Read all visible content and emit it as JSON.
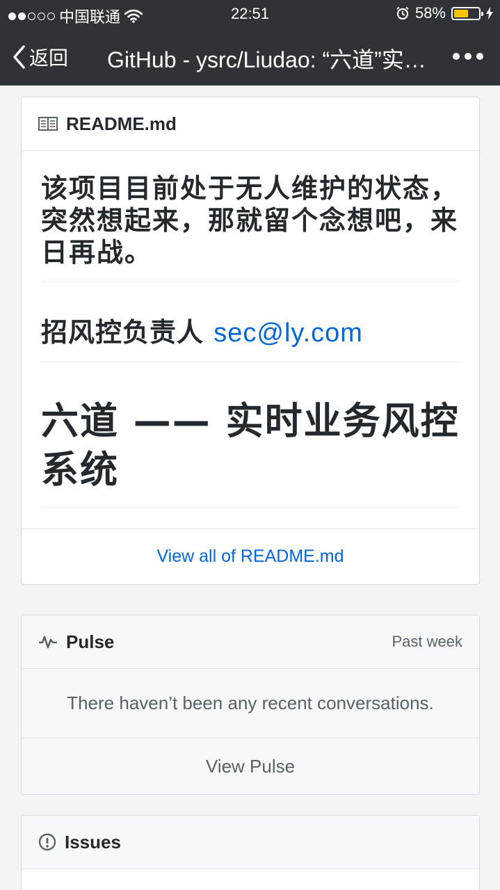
{
  "status_bar": {
    "carrier": "中国联通",
    "time": "22:51",
    "battery_percent": "58%",
    "battery_level": 0.58
  },
  "nav": {
    "back_label": "返回",
    "title": "GitHub - ysrc/Liudao: “六道”实时业务风控系统"
  },
  "readme": {
    "header": "README.md",
    "para1": "该项目目前处于无人维护的状态，突然想起来，那就留个念想吧，来日再战。",
    "para2_text": "招风控负责人 ",
    "para2_email": "sec@ly.com",
    "heading": "六道 —— 实时业务风控系统",
    "view_all": "View all of README.md"
  },
  "pulse": {
    "title": "Pulse",
    "period": "Past week",
    "message": "There haven’t been any recent conversations.",
    "view": "View Pulse"
  },
  "issues": {
    "title": "Issues"
  },
  "icons": {
    "book": "book-icon",
    "pulse": "pulse-icon",
    "issue": "issue-opened-icon",
    "wifi": "wifi-icon",
    "alarm": "alarm-icon",
    "charging": "charging-bolt-icon"
  },
  "colors": {
    "topbar": "#2f3236",
    "link": "#0366d6",
    "battery": "#f5c400"
  }
}
